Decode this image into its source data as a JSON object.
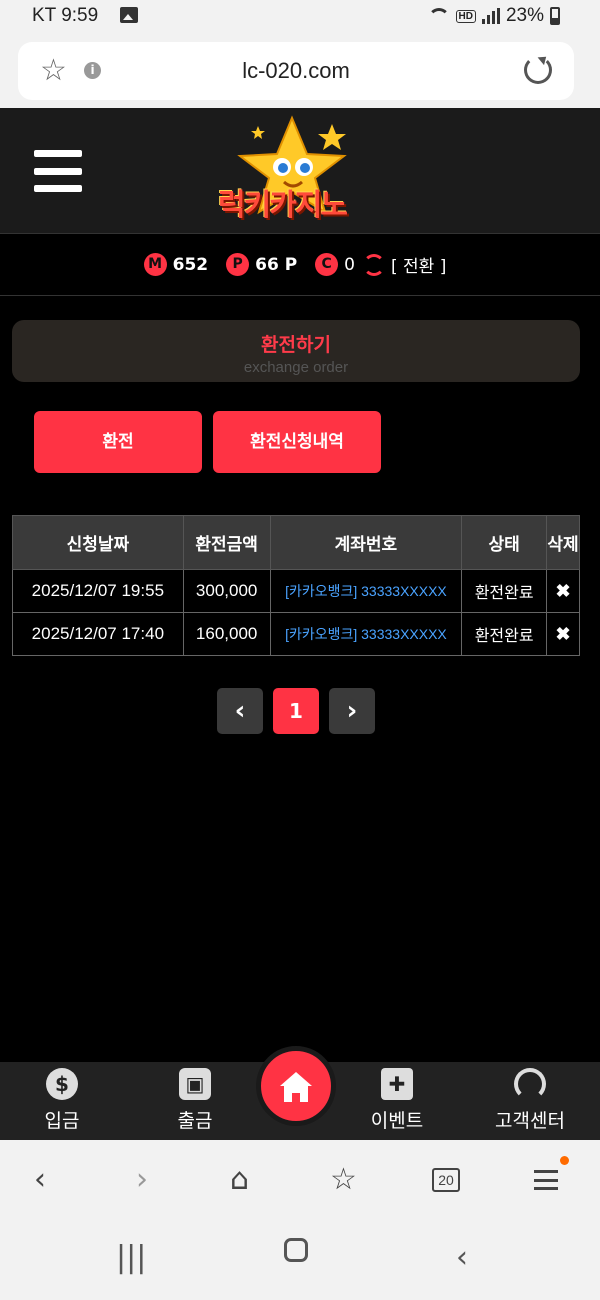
{
  "status_bar": {
    "carrier_time": "KT 9:59",
    "battery": "23%"
  },
  "browser": {
    "url": "lc-020.com",
    "tabs_count": "20"
  },
  "site": {
    "logo_text": "럭키카지노"
  },
  "balance": {
    "money_badge": "M",
    "money": "652",
    "point_badge": "P",
    "points": "66 P",
    "casino_badge": "C",
    "casino": "0",
    "switch_label": "[ 전환 ]"
  },
  "page": {
    "title": "환전하기",
    "subtitle": "exchange order"
  },
  "tabs": {
    "exchange": "환전",
    "history": "환전신청내역"
  },
  "table": {
    "headers": [
      "신청날짜",
      "환전금액",
      "계좌번호",
      "상태",
      "삭제"
    ],
    "rows": [
      {
        "date": "2025/12/07 19:55",
        "amount": "300,000",
        "account": "[카카오뱅크] 33333XXXXX",
        "status": "환전완료",
        "delete": "✖"
      },
      {
        "date": "2025/12/07 17:40",
        "amount": "160,000",
        "account": "[카카오뱅크] 33333XXXXX",
        "status": "환전완료",
        "delete": "✖"
      }
    ]
  },
  "pagination": {
    "prev": "‹",
    "current": "1",
    "next": "›"
  },
  "bottom_nav": {
    "deposit": "입금",
    "withdraw": "출금",
    "event": "이벤트",
    "support": "고객센터"
  },
  "colors": {
    "accent": "#ff3344",
    "link": "#4aa3ff",
    "header_bg": "#1b1b1b"
  }
}
